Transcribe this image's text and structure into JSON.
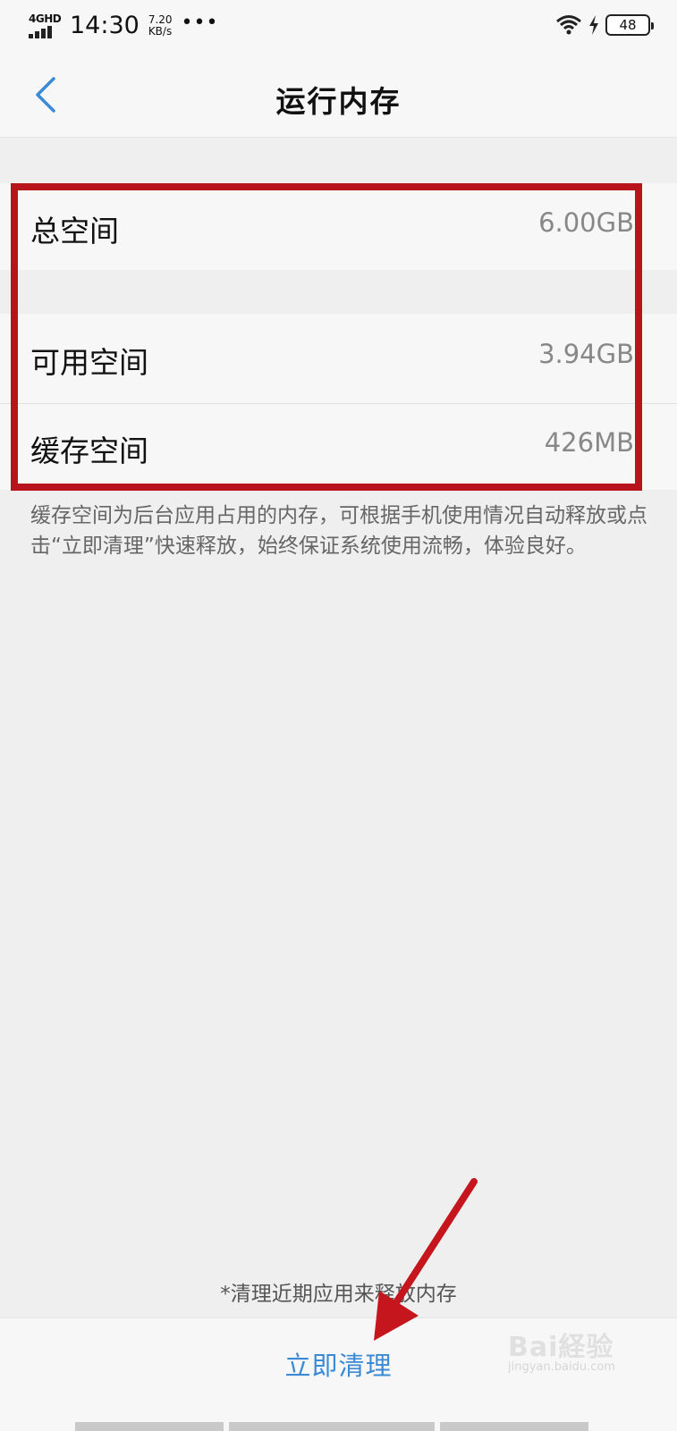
{
  "status_bar": {
    "network": "4GHD",
    "time": "14:30",
    "speed_value": "7.20",
    "speed_unit": "KB/s",
    "more_dots": "•••",
    "battery": "48"
  },
  "header": {
    "title": "运行内存"
  },
  "memory": {
    "total_label": "总空间",
    "total_value": "6.00GB",
    "available_label": "可用空间",
    "available_value": "3.94GB",
    "cache_label": "缓存空间",
    "cache_value": "426MB"
  },
  "description": "缓存空间为后台应用占用的内存，可根据手机使用情况自动释放或点击“立即清理”快速释放，始终保证系统使用流畅，体验良好。",
  "footer": {
    "hint": "*清理近期应用来释放内存",
    "clean_button": "立即清理"
  },
  "watermark": {
    "text": "Bai経验",
    "sub": "jingyan.baidu.com"
  },
  "colors": {
    "accent": "#3a8ad6",
    "highlight": "#b7141c"
  }
}
